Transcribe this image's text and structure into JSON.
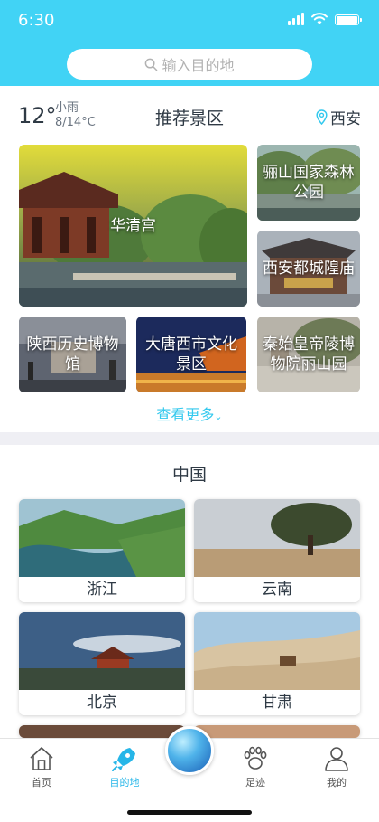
{
  "status": {
    "time": "6:30"
  },
  "search": {
    "placeholder": "输入目的地",
    "icon": "search-icon"
  },
  "weather": {
    "temp": "12°",
    "condition": "小雨",
    "range": "8/14°C"
  },
  "recommend": {
    "title": "推荐景区",
    "location": "西安",
    "spots": [
      {
        "name": "华清宫"
      },
      {
        "name": "骊山国家森林公园"
      },
      {
        "name": "西安都城隍庙"
      },
      {
        "name": "陕西历史博物馆"
      },
      {
        "name": "大唐西市文化景区"
      },
      {
        "name": "秦始皇帝陵博物院丽山园"
      }
    ],
    "more": "查看更多"
  },
  "china": {
    "title": "中国",
    "provinces": [
      {
        "name": "浙江"
      },
      {
        "name": "云南"
      },
      {
        "name": "北京"
      },
      {
        "name": "甘肃"
      }
    ]
  },
  "tabbar": {
    "items": [
      {
        "label": "首页",
        "icon": "home-icon"
      },
      {
        "label": "目的地",
        "icon": "rocket-icon"
      },
      {
        "label": "",
        "icon": "globe-icon"
      },
      {
        "label": "足迹",
        "icon": "paw-icon"
      },
      {
        "label": "我的",
        "icon": "user-icon"
      }
    ]
  },
  "colors": {
    "primary": "#41d3f5",
    "accent": "#34c9ee",
    "text": "#2f3a45"
  }
}
